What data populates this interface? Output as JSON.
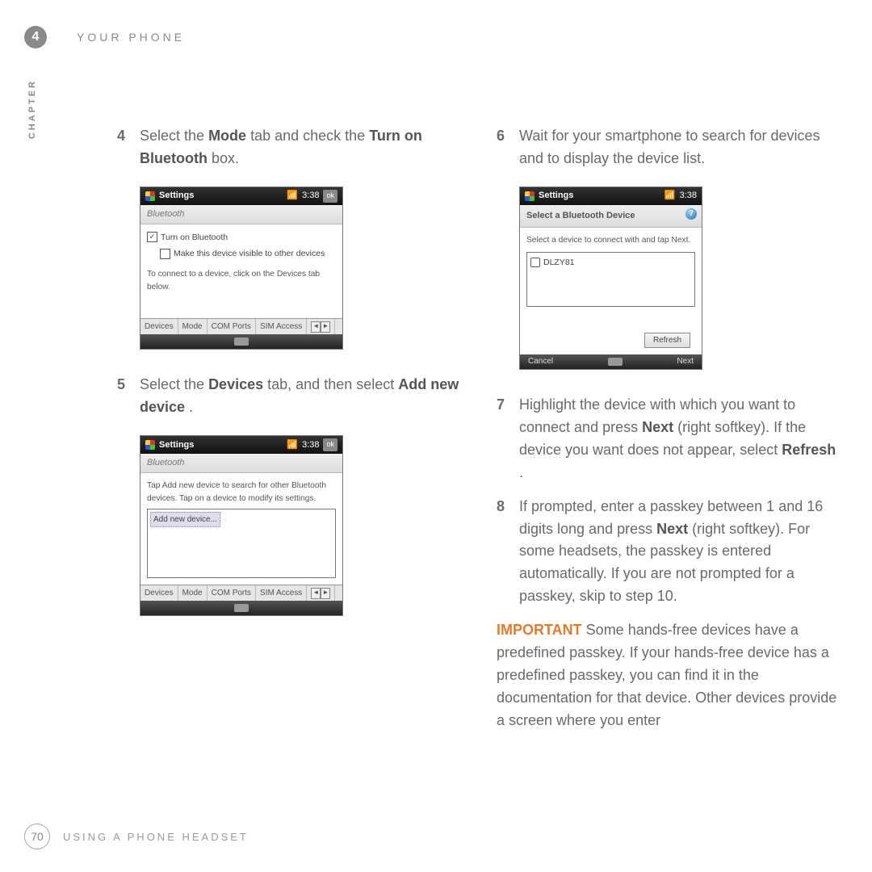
{
  "header": {
    "chapter_number": "4",
    "running_head": "YOUR PHONE",
    "vertical_label": "CHAPTER"
  },
  "left_column": {
    "step4": {
      "num": "4",
      "pre": "Select the ",
      "b1": "Mode",
      "mid": " tab and check the ",
      "b2": "Turn on Bluetooth",
      "post": " box."
    },
    "step5": {
      "num": "5",
      "pre": "Select the ",
      "b1": "Devices",
      "mid": " tab, and then select ",
      "b2": "Add new device",
      "post": "."
    }
  },
  "right_column": {
    "step6": {
      "num": "6",
      "text": "Wait for your smartphone to search for devices and to display the device list."
    },
    "step7": {
      "num": "7",
      "t1": "Highlight the device with which you want to connect and press ",
      "b1": "Next",
      "t2": " (right softkey). If the device you want does not appear, select ",
      "b2": "Refresh",
      "t3": "."
    },
    "step8": {
      "num": "8",
      "t1": "If prompted, enter a passkey between 1 and 16 digits long and press ",
      "b1": "Next",
      "t2": " (right softkey). For some headsets, the passkey is entered automatically. If you are not prompted for a passkey, skip to step 10."
    },
    "important": {
      "label": "IMPORTANT",
      "text": " Some hands-free devices have a predefined passkey. If your hands-free device has a predefined passkey, you can find it in the documentation for that device. Other devices provide a screen where you enter"
    }
  },
  "shot1": {
    "title": "Settings",
    "time": "3:38",
    "ok": "ok",
    "sub": "Bluetooth",
    "chk1": "Turn on Bluetooth",
    "chk2": "Make this device visible to other devices",
    "note": "To connect to a device, click on the Devices tab below.",
    "tabs": {
      "a": "Devices",
      "b": "Mode",
      "c": "COM Ports",
      "d": "SIM Access"
    }
  },
  "shot2": {
    "title": "Settings",
    "time": "3:38",
    "ok": "ok",
    "sub": "Bluetooth",
    "note": "Tap Add new device to search for other Bluetooth devices. Tap on a device to modify its settings.",
    "add": "Add new device...",
    "tabs": {
      "a": "Devices",
      "b": "Mode",
      "c": "COM Ports",
      "d": "SIM Access"
    }
  },
  "shot3": {
    "title": "Settings",
    "time": "3:38",
    "sub": "Select a Bluetooth Device",
    "note": "Select a device to connect with and tap Next.",
    "device": "DLZY81",
    "refresh": "Refresh",
    "cancel": "Cancel",
    "next": "Next"
  },
  "footer": {
    "page": "70",
    "section": "USING A PHONE HEADSET"
  }
}
